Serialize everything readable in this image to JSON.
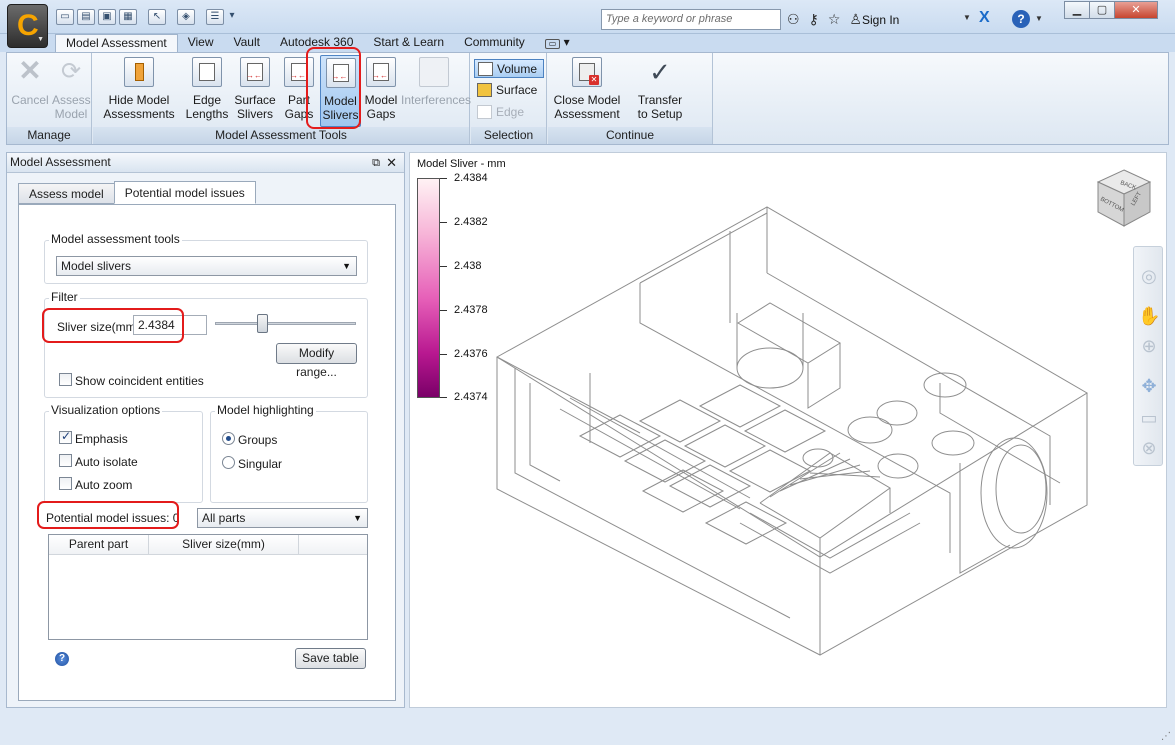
{
  "app": {
    "search_placeholder": "Type a keyword or phrase",
    "sign_in": "Sign In",
    "help_label": "?"
  },
  "ribbon": {
    "tabs": [
      "Model Assessment",
      "View",
      "Vault",
      "Autodesk 360",
      "Start & Learn",
      "Community"
    ],
    "groups": {
      "manage": "Manage",
      "tools": "Model Assessment Tools",
      "selection": "Selection",
      "continue": "Continue"
    },
    "buttons": {
      "cancel": "Cancel",
      "assess_model": [
        "Assess",
        "Model"
      ],
      "hide_model_assessments": [
        "Hide Model",
        "Assessments"
      ],
      "edge_lengths": [
        "Edge",
        "Lengths"
      ],
      "surface_slivers": [
        "Surface",
        "Slivers"
      ],
      "part_gaps": [
        "Part",
        "Gaps"
      ],
      "model_slivers": [
        "Model",
        "Slivers"
      ],
      "model_gaps": [
        "Model",
        "Gaps"
      ],
      "interferences": "Interferences",
      "close_model_assessment": [
        "Close Model",
        "Assessment"
      ],
      "transfer_to_setup": [
        "Transfer",
        "to Setup"
      ]
    },
    "selection": [
      "Volume",
      "Surface",
      "Edge"
    ]
  },
  "panel": {
    "title": "Model Assessment",
    "tabs": [
      "Assess model",
      "Potential model issues"
    ],
    "tools_group": "Model assessment tools",
    "tools_value": "Model slivers",
    "filter_group": "Filter",
    "sliver_label": "Sliver size(mm)",
    "sliver_value": "2.4384",
    "slider_position": 0.33,
    "modify_range": "Modify range...",
    "show_coincident": "Show coincident entities",
    "viz_group": "Visualization options",
    "viz": {
      "emphasis": "Emphasis",
      "auto_isolate": "Auto isolate",
      "auto_zoom": "Auto zoom"
    },
    "highlight_group": "Model highlighting",
    "highlight": {
      "groups": "Groups",
      "singular": "Singular"
    },
    "issues_label": "Potential model issues: 0",
    "parts_filter": "All parts",
    "columns": [
      "Parent part",
      "Sliver size(mm)"
    ],
    "save_table": "Save table"
  },
  "viewport": {
    "legend_title": "Model Sliver - mm",
    "legend_values": [
      "2.4384",
      "2.4382",
      "2.438",
      "2.4378",
      "2.4376",
      "2.4374"
    ],
    "colors": {
      "legend_top": "#fff2f4",
      "legend_bottom": "#7a0068"
    }
  },
  "viewcube_labels": {
    "top": "BACK",
    "front": "BOTTOM",
    "side": "LEFT"
  }
}
